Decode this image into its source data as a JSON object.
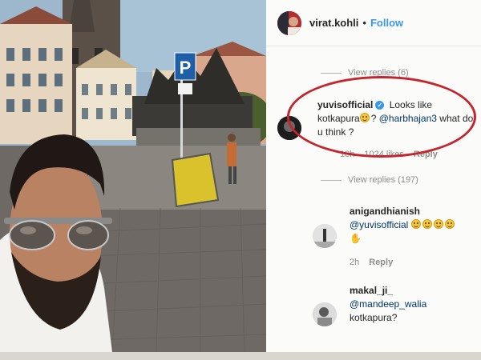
{
  "header": {
    "username": "virat.kohli",
    "separator": "•",
    "follow_label": "Follow"
  },
  "thread": {
    "top_view_replies": "View replies (6)",
    "highlighted_comment": {
      "username": "yuvisofficial",
      "text_part1": "Looks like kotkapura",
      "text_part2": "? ",
      "mention": "@harbhajan3",
      "text_part3": " what do u think ?",
      "time": "18h",
      "likes": "1024 likes",
      "reply_label": "Reply"
    },
    "mid_view_replies": "View replies (197)",
    "comments": [
      {
        "username": "anigandhianish",
        "mention": "@yuvisofficial",
        "time": "2h",
        "reply_label": "Reply"
      },
      {
        "username": "makal_ji_",
        "mention": "@mandeep_walia",
        "text": "kotkapura?"
      }
    ]
  },
  "photo": {
    "parking_sign": "P",
    "colors": {
      "sky": "#9bb6cc",
      "pavement": "#6f6a66",
      "sign_blue": "#1f5fa8"
    }
  },
  "colors": {
    "accent_blue": "#3897f0",
    "highlight_red": "#c4262e"
  },
  "icons": {
    "verified": "verified-badge-icon",
    "emoji": "smile-emoji-icon",
    "hand": "hand-emoji-icon"
  }
}
